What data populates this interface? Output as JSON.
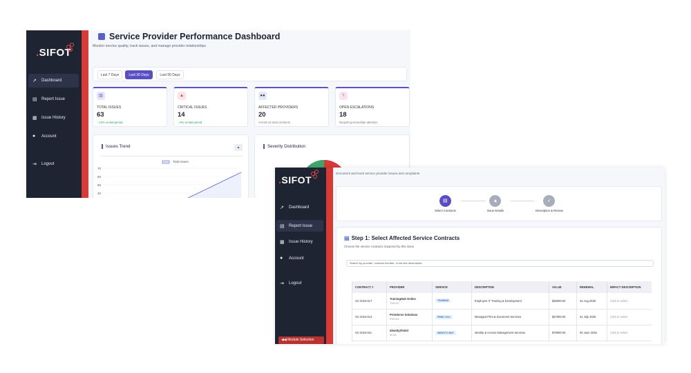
{
  "back_window": {
    "brand": "SIFOT",
    "nav": [
      {
        "label": "Dashboard",
        "icon": "chart-line-icon"
      },
      {
        "label": "Report Issue",
        "icon": "document-icon"
      },
      {
        "label": "Issue History",
        "icon": "list-icon"
      },
      {
        "label": "Account",
        "icon": "user-icon"
      },
      {
        "label": "Logout",
        "icon": "logout-icon"
      }
    ],
    "title": "Service Provider Performance Dashboard",
    "subtitle": "Monitor service quality, track issues, and manage provider relationships",
    "periods": [
      "Last 7 Days",
      "Last 30 Days",
      "Last 90 Days"
    ],
    "active_period": "Last 30 Days",
    "cards": [
      {
        "label": "Total Issues",
        "value": "63",
        "note": "↑ 12% vs last period",
        "note_color": "#2e9a5b",
        "icon": "bar-chart-icon"
      },
      {
        "label": "Critical Issues",
        "value": "14",
        "note": "↓ 8% vs last period",
        "note_color": "#2e9a5b",
        "icon": "fire-icon"
      },
      {
        "label": "Affected Providers",
        "value": "20",
        "note": "Across 43 total contracts",
        "note_color": "#777777",
        "icon": "users-icon"
      },
      {
        "label": "Open Escalations",
        "value": "18",
        "note": "Requiring immediate attention",
        "note_color": "#777777",
        "icon": "bolt-icon"
      }
    ],
    "trend_panel": {
      "title": "Issues Trend",
      "legend": "Total Issues",
      "y_ticks": [
        "70",
        "60",
        "50",
        "40",
        "30"
      ]
    },
    "severity_panel": {
      "title": "Severity Distribution"
    }
  },
  "front_window": {
    "brand": "SIFOT",
    "nav": [
      {
        "label": "Dashboard",
        "icon": "chart-line-icon"
      },
      {
        "label": "Report Issue",
        "icon": "document-icon"
      },
      {
        "label": "Issue History",
        "icon": "list-icon"
      },
      {
        "label": "Account",
        "icon": "user-icon"
      },
      {
        "label": "Logout",
        "icon": "logout-icon"
      }
    ],
    "module_button": "Module Selection",
    "subtitle": "Document and track service provider issues and complaints",
    "steps": [
      {
        "label": "Select Contracts",
        "icon": "document-icon",
        "color": "#5a4fc2"
      },
      {
        "label": "Issue Details",
        "icon": "warning-icon",
        "color": "#a7adbb"
      },
      {
        "label": "Description & Review",
        "icon": "check-icon",
        "color": "#a7adbb"
      }
    ],
    "step_title": "Step 1: Select Affected Service Contracts",
    "step_subtitle": "Choose the service contracts impacted by this issue",
    "search_placeholder": "Search by provider, contract number, or service description...",
    "table": {
      "headers": [
        "CONTRACT #",
        "PROVIDER",
        "SERVICE",
        "DESCRIPTION",
        "VALUE",
        "RENEWAL",
        "IMPACT DESCRIPTION"
      ],
      "rows": [
        {
          "contract": "SC-2024-017",
          "provider": "TrainingHub Online",
          "code": "THO-017",
          "service": "TRAINING",
          "description": "Employee IT Training & Development",
          "value": "$38000.00",
          "renewal": "31 Aug 2025",
          "impact": "Click to select"
        },
        {
          "contract": "SC-2024-014",
          "provider": "PrintServe Solutions",
          "code": "PSS-014",
          "service": "PRINT. SVC",
          "description": "Managed Print & Document Services",
          "value": "$27900.00",
          "renewal": "31 July 2025",
          "impact": "Click to select"
        },
        {
          "contract": "SC-2024-011",
          "provider": "IdentityShield",
          "code": "IS-011",
          "service": "IDENTITY MGT",
          "description": "Identity & Access Management Services",
          "value": "$78900.00",
          "renewal": "30 June 2025",
          "impact": "Click to select"
        }
      ]
    }
  }
}
